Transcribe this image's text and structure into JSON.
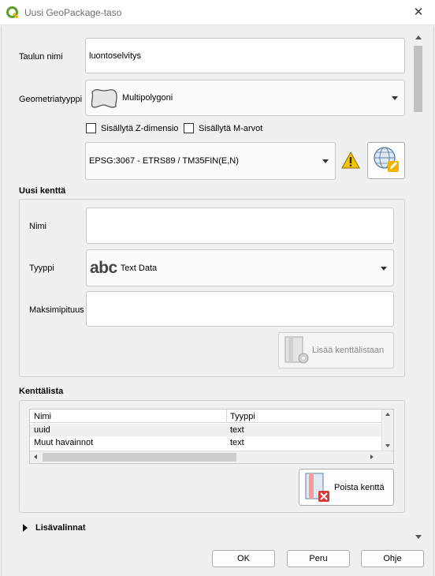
{
  "window": {
    "title": "Uusi GeoPackage-taso",
    "close_symbol": "✕"
  },
  "form": {
    "table_name_label": "Taulun nimi",
    "table_name_value": "luontoselvitys",
    "geometry_type_label": "Geometriatyyppi",
    "geometry_type_value": "Multipolygoni",
    "include_z_label": "Sisällytä Z-dimensio",
    "include_m_label": "Sisällytä M-arvot",
    "crs_value": "EPSG:3067 - ETRS89 / TM35FIN(E,N)"
  },
  "new_field": {
    "section_title": "Uusi kenttä",
    "name_label": "Nimi",
    "name_value": "",
    "type_label": "Tyyppi",
    "type_icon_text": "abc",
    "type_value": "Text Data",
    "max_length_label": "Maksimipituus",
    "max_length_value": "",
    "add_button_label": "Lisää kenttälistaan"
  },
  "field_list": {
    "section_title": "Kenttälista",
    "columns": [
      "Nimi",
      "Tyyppi"
    ],
    "rows": [
      {
        "name": "uuid",
        "type": "text"
      },
      {
        "name": "Muut havainnot",
        "type": "text"
      }
    ],
    "remove_button_label": "Poista kenttä"
  },
  "advanced": {
    "label": "Lisävalinnat"
  },
  "buttons": {
    "ok": "OK",
    "cancel": "Peru",
    "help": "Ohje"
  },
  "colors": {
    "accent_green": "#5a9e2f",
    "warning_yellow": "#f5c400",
    "delete_red": "#d63a3a"
  }
}
